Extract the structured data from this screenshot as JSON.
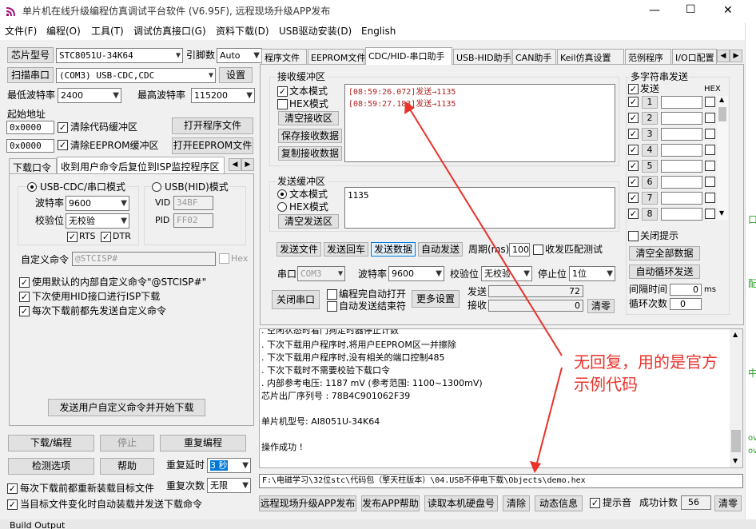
{
  "window": {
    "title": "单片机在线升级编程仿真调试平台软件 (V6.95F), 远程现场升级APP发布",
    "min": "—",
    "max": "☐",
    "close": "✕"
  },
  "menu": [
    "文件(F)",
    "编程(O)",
    "工具(T)",
    "调试仿真接口(G)",
    "资料下载(D)",
    "USB驱动安装(D)",
    "English"
  ],
  "left": {
    "chip_label": "芯片型号",
    "chip_value": "STC8051U-34K64",
    "pin_label": "引脚数",
    "pin_value": "Auto",
    "scan_btn": "扫描串口",
    "port_value": "(COM3) USB-CDC,CDC",
    "settings_btn": "设置",
    "min_baud_label": "最低波特率",
    "min_baud": "2400",
    "max_baud_label": "最高波特率",
    "max_baud": "115200",
    "start_addr_label": "起始地址",
    "addr1": "0x0000",
    "clear_code": "清除代码缓冲区",
    "open_prog": "打开程序文件",
    "addr2": "0x0000",
    "clear_eeprom": "清除EEPROM缓冲区",
    "open_eeprom": "打开EEPROM文件",
    "tabs": [
      "下载口令",
      "收到用户命令后复位到ISP监控程序区"
    ],
    "usb_cdc_mode": "USB-CDC/串口模式",
    "usb_hid_mode": "USB(HID)模式",
    "baud_label": "波特率",
    "baud_value": "9600",
    "parity_label": "校验位",
    "parity_value": "无校验",
    "rts": "RTS",
    "dtr": "DTR",
    "vid_label": "VID",
    "vid": "34BF",
    "pid_label": "PID",
    "pid": "FF02",
    "custom_cmd_label": "自定义命令",
    "custom_cmd": "@STCISP#",
    "hex": "Hex",
    "opt1": "使用默认的内部自定义命令\"@STCISP#\"",
    "opt2": "下次使用HID接口进行ISP下载",
    "opt3": "每次下载前都先发送自定义命令",
    "send_custom_btn": "发送用户自定义命令并开始下载",
    "download_btn": "下载/编程",
    "stop_btn": "停止",
    "reprog_btn": "重复编程",
    "check_btn": "检测选项",
    "help_btn": "帮助",
    "repeat_delay_label": "重复延时",
    "repeat_delay": "3 秒",
    "reload_each": "每次下载前都重新装载目标文件",
    "repeat_count_label": "重复次数",
    "repeat_count": "无限",
    "auto_reload": "当目标文件变化时自动装载并发送下载命令"
  },
  "tabs": [
    "程序文件",
    "EEPROM文件",
    "CDC/HID-串口助手",
    "USB-HID助手",
    "CAN助手",
    "Keil仿真设置",
    "范例程序",
    "I/O口配置"
  ],
  "serial": {
    "recv_title": "接收缓冲区",
    "text_mode": "文本模式",
    "hex_mode": "HEX模式",
    "clear_recv": "清空接收区",
    "save_recv": "保存接收数据",
    "copy_recv": "复制接收数据",
    "recv_lines": [
      "[08:59:26.072]发送→1135",
      "[08:59:27.183]发送→1135"
    ],
    "send_title": "发送缓冲区",
    "send_text": "1135",
    "clear_send": "清空发送区",
    "send_file": "发送文件",
    "send_enter": "发送回车",
    "send_data": "发送数据",
    "auto_send": "自动发送",
    "period_label": "周期(ms)",
    "period": "100",
    "match_label": "收发匹配测试",
    "port_label": "串口",
    "port": "COM3",
    "baud_label": "波特率",
    "baud": "9600",
    "parity_label": "校验位",
    "parity": "无校验",
    "stop_label": "停止位",
    "stop": "1位",
    "close_port": "关闭串口",
    "prog_open": "编程完自动打开",
    "auto_end": "自动发送结束符",
    "more_settings": "更多设置",
    "sent_label": "发送",
    "sent_count": "72",
    "recv_label": "接收",
    "recv_count": "0",
    "clear_counts": "清零"
  },
  "multi": {
    "title": "多字符串发送",
    "send_col": "发送",
    "hex_col": "HEX",
    "rows": [
      "1",
      "2",
      "3",
      "4",
      "5",
      "6",
      "7",
      "8"
    ],
    "close_tip": "关闭提示",
    "clear_all": "清空全部数据",
    "auto_loop": "自动循环发送",
    "interval_label": "间隔时间",
    "interval": "0",
    "interval_unit": "ms",
    "loop_label": "循环次数",
    "loop": "0"
  },
  "log": {
    "lines": [
      ". 空闲状态时看门狗定时器停止计数",
      ". 下次下载用户程序时,将用户EEPROM区一并擦除",
      ". 下次下载用户程序时,没有相关的端口控制485",
      ". 下次下载时不需要校验下载口令",
      ". 内部参考电压: 1187 mV (参考范围: 1100~1300mV)",
      "芯片出厂序列号 : 78B4C901062F39",
      "",
      "  单片机型号: AI8051U-34K64",
      "",
      "操作成功 !"
    ]
  },
  "annotation": {
    "text1": "无回复，用的是官方",
    "text2": "示例代码",
    "color": "#e8322a"
  },
  "path": "F:\\电磁学习\\32位stc\\代码包（擎天柱版本）\\04.USB不停电下载\\Objects\\demo.hex",
  "bottom": {
    "remote": "远程现场升级APP发布",
    "publish_help": "发布APP帮助",
    "read_hdd": "读取本机硬盘号",
    "clear": "清除",
    "dyn_info": "动态信息",
    "beep": "提示音",
    "success_label": "成功计数",
    "success": "56",
    "clear2": "清零"
  },
  "status": {
    "build_output": "Build Output"
  },
  "edge": {
    "e1": "口",
    "e2": "配",
    "e3": "中",
    "e4": "ov",
    "e5": "ov"
  }
}
